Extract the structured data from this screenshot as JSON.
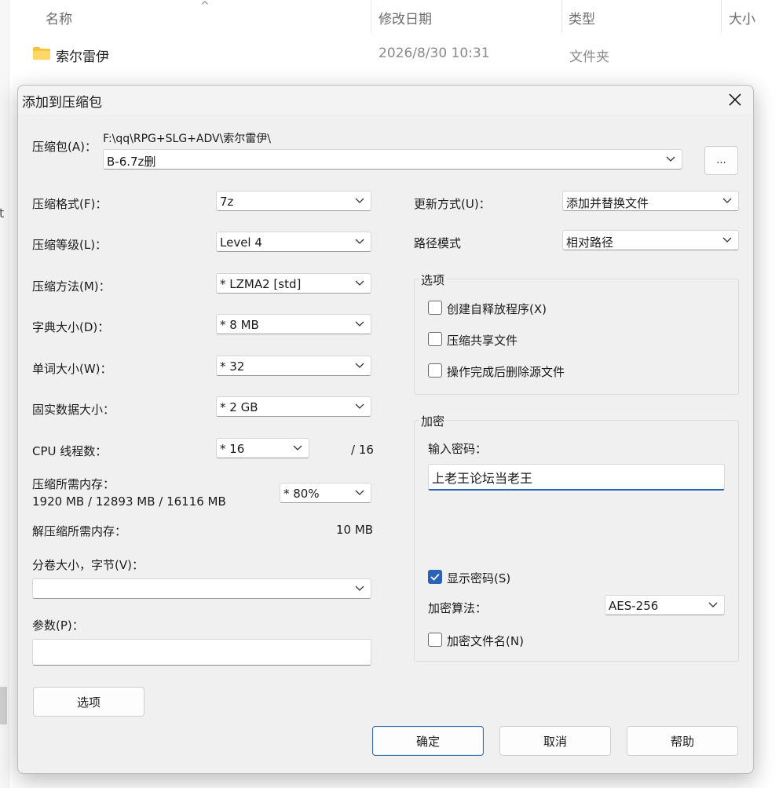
{
  "explorer": {
    "columns": {
      "name": "名称",
      "modified": "修改日期",
      "type": "类型",
      "size": "大小"
    },
    "sort_caret": "^",
    "row": {
      "name": "索尔雷伊",
      "modified": "2026/8/30 10:31",
      "type": "文件夹"
    },
    "stray_char": "t"
  },
  "dialog": {
    "title": "添加到压缩包",
    "archive_label": "压缩包(A)：",
    "archive_path": "F:\\qq\\RPG+SLG+ADV\\索尔雷伊\\",
    "archive_name": "B-6.7z删",
    "browse_label": "...",
    "format_label": "压缩格式(F)：",
    "format_value": "7z",
    "level_label": "压缩等级(L)：",
    "level_value": "Level 4",
    "method_label": "压缩方法(M)：",
    "method_value": "*  LZMA2 [std]",
    "dict_label": "字典大小(D)：",
    "dict_value": "*  8 MB",
    "word_label": "单词大小(W)：",
    "word_value": "*  32",
    "solid_label": "固实数据大小：",
    "solid_value": "*  2 GB",
    "threads_label": "CPU 线程数：",
    "threads_value": "*  16",
    "threads_max": "/ 16",
    "mem_label": "压缩所需内存：",
    "mem_value": "1920 MB / 12893 MB / 16116 MB",
    "mem_percent": "* 80%",
    "decomp_label": "解压缩所需内存：",
    "decomp_value": "10 MB",
    "split_label": "分卷大小，字节(V)：",
    "split_value": "",
    "params_label": "参数(P)：",
    "params_value": "",
    "options_button": "选项",
    "update_label": "更新方式(U)：",
    "update_value": "添加并替换文件",
    "path_label": "路径模式",
    "path_value": "相对路径",
    "options_group": {
      "title": "选项",
      "sfx": "创建自释放程序(X)",
      "shared": "压缩共享文件",
      "delete": "操作完成后删除源文件"
    },
    "encrypt_group": {
      "title": "加密",
      "password_label": "输入密码：",
      "password_value": "上老王论坛当老王",
      "show_password": "显示密码(S)",
      "method_label": "加密算法：",
      "method_value": "AES-256",
      "encrypt_names": "加密文件名(N)"
    },
    "ok": "确定",
    "cancel": "取消",
    "help": "帮助"
  },
  "colors": {
    "accent": "#2a62b8",
    "dialog_bg": "#f0f0f0",
    "folder": "#f4c542"
  }
}
